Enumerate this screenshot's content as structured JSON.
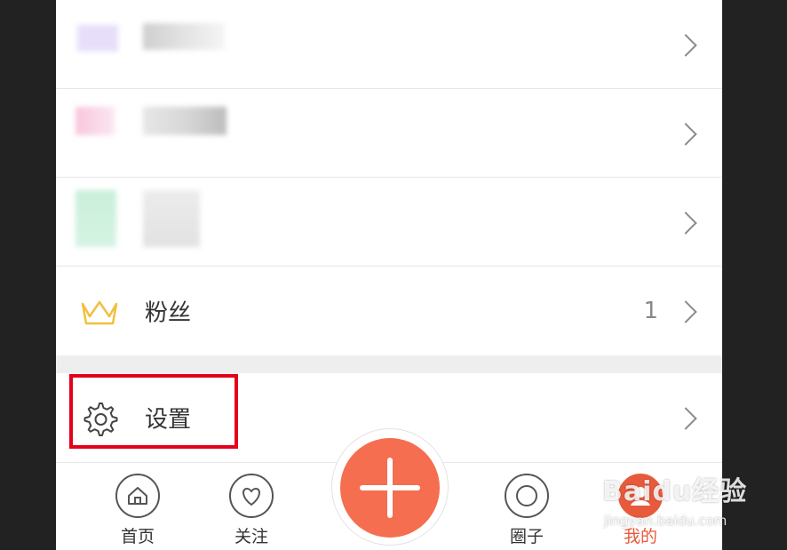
{
  "menu": {
    "rows": [
      {
        "label": "",
        "count": "",
        "icon": "blurred-icon",
        "blurred": true
      },
      {
        "label": "",
        "count": "",
        "icon": "blurred-icon",
        "blurred": true
      },
      {
        "label": "",
        "count": "",
        "icon": "blurred-icon",
        "blurred": true
      },
      {
        "label": "粉丝",
        "count": "1",
        "icon": "crown-icon",
        "blurred": false
      }
    ],
    "settings": {
      "label": "设置",
      "icon": "gear-icon"
    }
  },
  "tabbar": {
    "tabs": [
      {
        "label": "首页",
        "icon": "home-icon"
      },
      {
        "label": "关注",
        "icon": "heart-icon"
      },
      {
        "label": "圈子",
        "icon": "circle-icon"
      },
      {
        "label": "我的",
        "icon": "profile-icon",
        "active": true
      }
    ],
    "fab_icon": "plus-icon"
  },
  "watermark": {
    "brand": "Baidu经验",
    "url": "jingyan.baidu.com"
  },
  "colors": {
    "accent": "#f56e4f",
    "highlight_border": "#e3001b",
    "crown": "#f0c040",
    "active_tab": "#e85a3c"
  }
}
